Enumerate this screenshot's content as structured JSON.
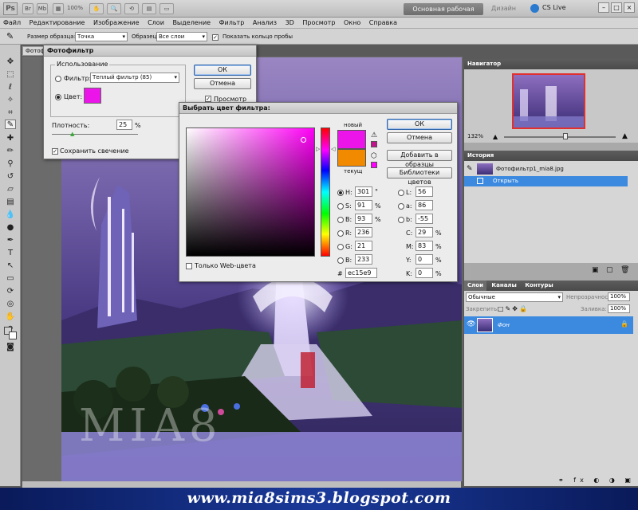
{
  "app": {
    "logo": "Ps",
    "zoom": "100%",
    "workspace": "Основная рабочая среда",
    "design_link": "Дизайн",
    "cslive": "CS Live",
    "win_minimize": "–",
    "win_restore": "□",
    "win_close": "×"
  },
  "menu": [
    "Файл",
    "Редактирование",
    "Изображение",
    "Слои",
    "Выделение",
    "Фильтр",
    "Анализ",
    "3D",
    "Просмотр",
    "Окно",
    "Справка"
  ],
  "options": {
    "sample_size_label": "Размер образца:",
    "sample_size_value": "Точка",
    "sample_label": "Образец:",
    "sample_value": "Все слои",
    "show_ring_label": "Показать кольцо пробы"
  },
  "document": {
    "tab": "Фотофильтр",
    "watermark": "MIA8"
  },
  "photo_filter": {
    "title": "Фотофильтр",
    "use_label": "Использование",
    "filter_label": "Фильтр:",
    "filter_value": "Теплый фильтр (85)",
    "color_label": "Цвет:",
    "color_hex": "#ec15e9",
    "density_label": "Плотность:",
    "density_value": "25",
    "density_unit": "%",
    "density_fraction": 0.25,
    "preserve_label": "Сохранить свечение",
    "ok": "ОК",
    "cancel": "Отмена",
    "preview": "Просмотр"
  },
  "color_picker": {
    "title": "Выбрать цвет фильтра:",
    "new_label": "новый",
    "current_label": "текущ",
    "new_color": "#ec15e9",
    "current_color": "#f28a00",
    "ok": "ОК",
    "cancel": "Отмена",
    "add_swatches": "Добавить в образцы",
    "color_libraries": "Библиотеки цветов",
    "web_only": "Только Web-цвета",
    "hex_prefix": "#",
    "hex": "ec15e9",
    "fields": [
      {
        "label": "H:",
        "value": "301",
        "unit": "°",
        "radio": true,
        "on": true
      },
      {
        "label": "S:",
        "value": "91",
        "unit": "%",
        "radio": true,
        "on": false
      },
      {
        "label": "B:",
        "value": "93",
        "unit": "%",
        "radio": true,
        "on": false
      },
      {
        "label": "R:",
        "value": "236",
        "unit": "",
        "radio": true,
        "on": false
      },
      {
        "label": "G:",
        "value": "21",
        "unit": "",
        "radio": true,
        "on": false
      },
      {
        "label": "B:",
        "value": "233",
        "unit": "",
        "radio": true,
        "on": false
      }
    ],
    "lab_fields": [
      {
        "label": "L:",
        "value": "56"
      },
      {
        "label": "a:",
        "value": "86"
      },
      {
        "label": "b:",
        "value": "-55"
      }
    ],
    "cmyk_fields": [
      {
        "label": "C:",
        "value": "29",
        "unit": "%"
      },
      {
        "label": "M:",
        "value": "83",
        "unit": "%"
      },
      {
        "label": "Y:",
        "value": "0",
        "unit": "%"
      },
      {
        "label": "K:",
        "value": "0",
        "unit": "%"
      }
    ]
  },
  "navigator": {
    "title": "Навигатор",
    "zoom": "132%"
  },
  "history": {
    "title": "История",
    "snapshot": "Фотофильтр1_mia8.jpg",
    "step": "Открыть"
  },
  "layers": {
    "tabs": [
      "Слои",
      "Каналы",
      "Контуры"
    ],
    "blend_mode": "Обычные",
    "opacity_label": "Непрозрачность:",
    "opacity_value": "100%",
    "lock_label": "Закрепить:",
    "fill_label": "Заливка:",
    "fill_value": "100%",
    "layer_name": "Фон"
  },
  "banner": "www.mia8sims3.blogspot.com"
}
